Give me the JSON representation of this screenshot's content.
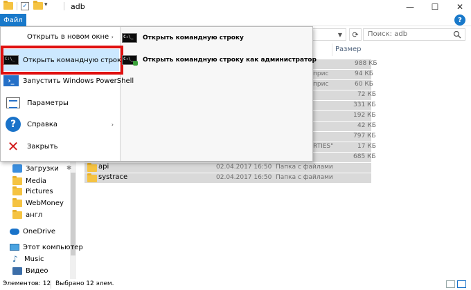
{
  "window": {
    "title": "adb",
    "controls": {
      "minimize": "—",
      "maximize": "☐",
      "close": "✕"
    }
  },
  "ribbon": {
    "file_tab": "Файл",
    "help": "?"
  },
  "address": {
    "refresh": "⟳",
    "search_placeholder": "Поиск: adb"
  },
  "file_menu": {
    "items": [
      {
        "label": "Открыть в новом окне",
        "has_submenu": true
      },
      {
        "label": "Открыть командную строку",
        "has_submenu": true,
        "highlighted": true
      },
      {
        "label": "Запустить Windows PowerShell",
        "has_submenu": true
      },
      {
        "label": "Параметры",
        "has_submenu": false
      },
      {
        "label": "Справка",
        "has_submenu": true
      },
      {
        "label": "Закрыть",
        "has_submenu": false
      }
    ],
    "submenu": [
      {
        "label": "Открыть командную строку"
      },
      {
        "label": "Открыть командную строку как администратор"
      }
    ],
    "arrow": "›",
    "cmd_glyph": "C:\\_"
  },
  "file_list": {
    "size_header": "Размер",
    "rows": [
      {
        "type_partial": "",
        "size": "988 КБ"
      },
      {
        "type_partial": "прис",
        "size": "94 КБ"
      },
      {
        "type_partial": "прис",
        "size": "60 КБ"
      },
      {
        "type_partial": "",
        "size": "72 КБ"
      },
      {
        "type_partial": "",
        "size": "331 КБ"
      },
      {
        "type_partial": "",
        "size": "192 КБ"
      },
      {
        "type_partial": "",
        "size": "42 КБ"
      },
      {
        "type_partial": "",
        "size": "797 КБ"
      },
      {
        "type_partial": "RTIES\"",
        "size": "17 КБ"
      },
      {
        "type_partial": "",
        "size": "685 КБ"
      }
    ],
    "folders": [
      {
        "name": "api",
        "date": "02.04.2017 16:50",
        "type": "Папка с файлами"
      },
      {
        "name": "systrace",
        "date": "02.04.2017 16:50",
        "type": "Папка с файлами"
      }
    ]
  },
  "nav_pane": {
    "items": [
      {
        "label": "Загрузки",
        "icon": "download-icon",
        "pin": "✱"
      },
      {
        "label": "Media",
        "icon": "folder-icon"
      },
      {
        "label": "Pictures",
        "icon": "folder-icon"
      },
      {
        "label": "WebMoney",
        "icon": "folder-icon"
      },
      {
        "label": "англ",
        "icon": "folder-icon"
      },
      {
        "label": "OneDrive",
        "icon": "onedrive-icon"
      },
      {
        "label": "Этот компьютер",
        "icon": "computer-icon"
      },
      {
        "label": "Music",
        "icon": "music-icon"
      },
      {
        "label": "Видео",
        "icon": "video-icon"
      }
    ]
  },
  "status_bar": {
    "count": "Элементов: 12",
    "selected": "Выбрано 12 элем."
  }
}
